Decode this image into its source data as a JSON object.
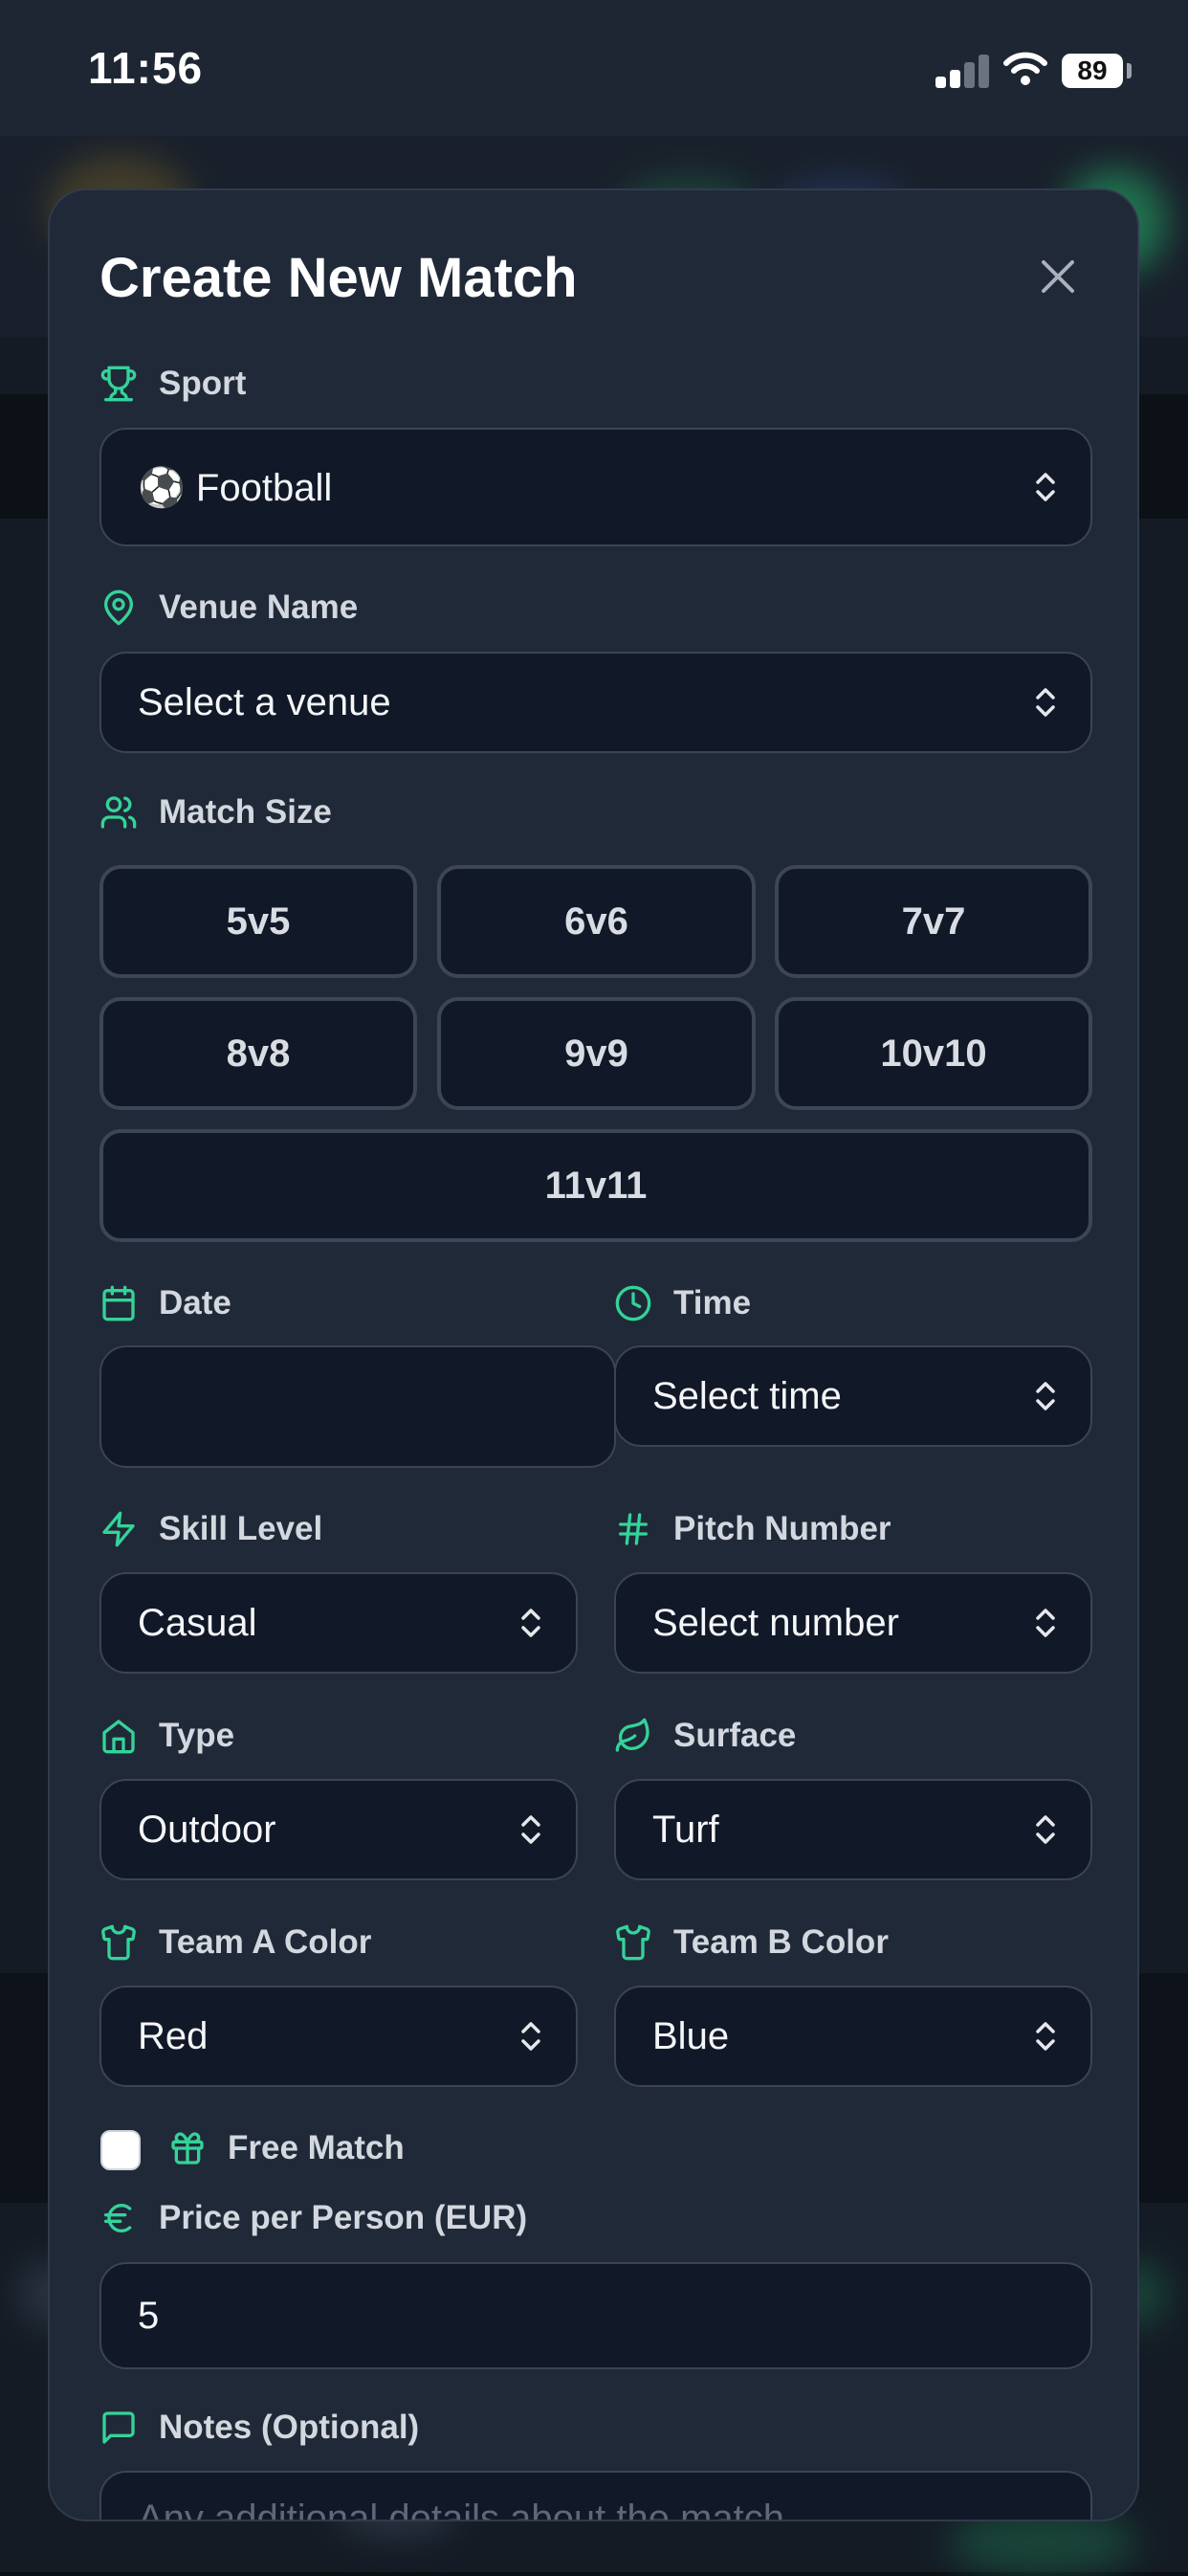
{
  "status_bar": {
    "time": "11:56",
    "battery": "89"
  },
  "modal": {
    "title": "Create New Match",
    "sport": {
      "label": "Sport",
      "value": "⚽  Football"
    },
    "venue": {
      "label": "Venue Name",
      "value": "Select a venue"
    },
    "match_size": {
      "label": "Match Size",
      "options": [
        "5v5",
        "6v6",
        "7v7",
        "8v8",
        "9v9",
        "10v10",
        "11v11"
      ]
    },
    "date": {
      "label": "Date",
      "value": ""
    },
    "time": {
      "label": "Time",
      "value": "Select time"
    },
    "skill_level": {
      "label": "Skill Level",
      "value": "Casual"
    },
    "pitch_number": {
      "label": "Pitch Number",
      "value": "Select number"
    },
    "type": {
      "label": "Type",
      "value": "Outdoor"
    },
    "surface": {
      "label": "Surface",
      "value": "Turf"
    },
    "team_a_color": {
      "label": "Team A Color",
      "value": "Red"
    },
    "team_b_color": {
      "label": "Team B Color",
      "value": "Blue"
    },
    "free_match": {
      "label": "Free Match",
      "checked": false
    },
    "price": {
      "label": "Price per Person (EUR)",
      "value": "5"
    },
    "notes": {
      "label": "Notes (Optional)",
      "placeholder": "Any additional details about the match..."
    }
  },
  "colors": {
    "accent": "#34d399",
    "modal_bg": "#202938",
    "field_bg": "#111827"
  },
  "icons": {
    "sport": "trophy-icon",
    "venue": "map-pin-icon",
    "match_size": "users-icon",
    "date": "calendar-icon",
    "time": "clock-icon",
    "skill_level": "zap-icon",
    "pitch_number": "hash-icon",
    "type": "home-icon",
    "surface": "leaf-icon",
    "team_color": "shirt-icon",
    "free_match": "gift-icon",
    "price": "euro-icon",
    "notes": "message-square-icon",
    "select": "chevron-up-down-icon",
    "close": "close-icon"
  }
}
